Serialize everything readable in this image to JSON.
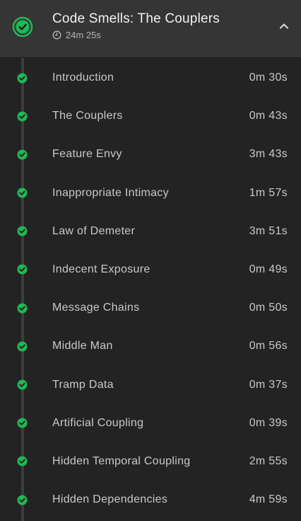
{
  "colors": {
    "accent_green": "#1fb954",
    "header_bg": "#353535",
    "list_bg": "#232323",
    "text_primary": "#f2f2f2",
    "text_secondary": "#c9c9c9"
  },
  "module": {
    "title": "Code Smells: The Couplers",
    "duration": "24m 25s",
    "status_icon": "check-circle-icon",
    "duration_icon": "clock-icon",
    "toggle_icon": "chevron-up-icon"
  },
  "clips": [
    {
      "title": "Introduction",
      "duration": "0m 30s"
    },
    {
      "title": "The Couplers",
      "duration": "0m 43s"
    },
    {
      "title": "Feature Envy",
      "duration": "3m 43s"
    },
    {
      "title": "Inappropriate Intimacy",
      "duration": "1m 57s"
    },
    {
      "title": "Law of Demeter",
      "duration": "3m 51s"
    },
    {
      "title": "Indecent Exposure",
      "duration": "0m 49s"
    },
    {
      "title": "Message Chains",
      "duration": "0m 50s"
    },
    {
      "title": "Middle Man",
      "duration": "0m 56s"
    },
    {
      "title": "Tramp Data",
      "duration": "0m 37s"
    },
    {
      "title": "Artificial Coupling",
      "duration": "0m 39s"
    },
    {
      "title": "Hidden Temporal Coupling",
      "duration": "2m 55s"
    },
    {
      "title": "Hidden Dependencies",
      "duration": "4m 59s"
    }
  ]
}
